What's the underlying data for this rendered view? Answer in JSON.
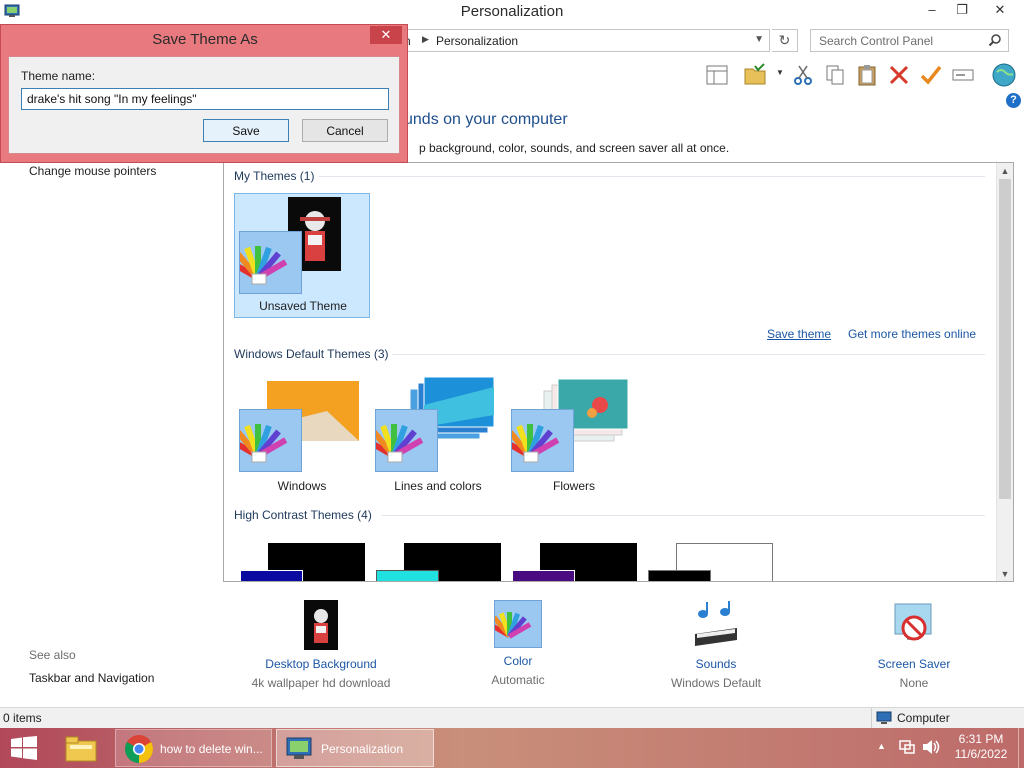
{
  "window": {
    "title": "Personalization",
    "address_fragment": "n",
    "address_current": "Personalization",
    "search_placeholder": "Search Control Panel",
    "help_label": "?",
    "minimize": "–",
    "maximize": "❐",
    "close": "✕"
  },
  "header": {
    "heading": "unds on your computer",
    "subheading": "p background, color, sounds, and screen saver all at once."
  },
  "sidebar": {
    "change_mouse_pointers": "Change mouse pointers",
    "see_also": "See also",
    "taskbar_navigation": "Taskbar and Navigation"
  },
  "themes": {
    "my_themes_title": "My Themes (1)",
    "unsaved_theme": "Unsaved Theme",
    "save_theme_link": "Save theme",
    "get_more_link": "Get more themes online",
    "default_title": "Windows Default Themes (3)",
    "defaults": [
      "Windows",
      "Lines and colors",
      "Flowers"
    ],
    "high_contrast_title": "High Contrast Themes (4)"
  },
  "bottom": {
    "desktop_background": "Desktop Background",
    "desktop_background_sub": "4k wallpaper hd download",
    "color": "Color",
    "color_sub": "Automatic",
    "sounds": "Sounds",
    "sounds_sub": "Windows Default",
    "screen_saver": "Screen Saver",
    "screen_saver_sub": "None"
  },
  "status": {
    "items": "0 items",
    "location": "Computer"
  },
  "taskbar": {
    "chrome_label": "how to delete win...",
    "personalization_label": "Personalization",
    "time": "6:31 PM",
    "date": "11/6/2022"
  },
  "dialog": {
    "title": "Save Theme As",
    "label": "Theme name:",
    "value": "drake's hit song \"In my feelings\"",
    "save": "Save",
    "cancel": "Cancel"
  },
  "colors": {
    "dialog_frame": "#e8797e",
    "link_blue": "#1c57a6",
    "selection": "#cce8ff"
  }
}
